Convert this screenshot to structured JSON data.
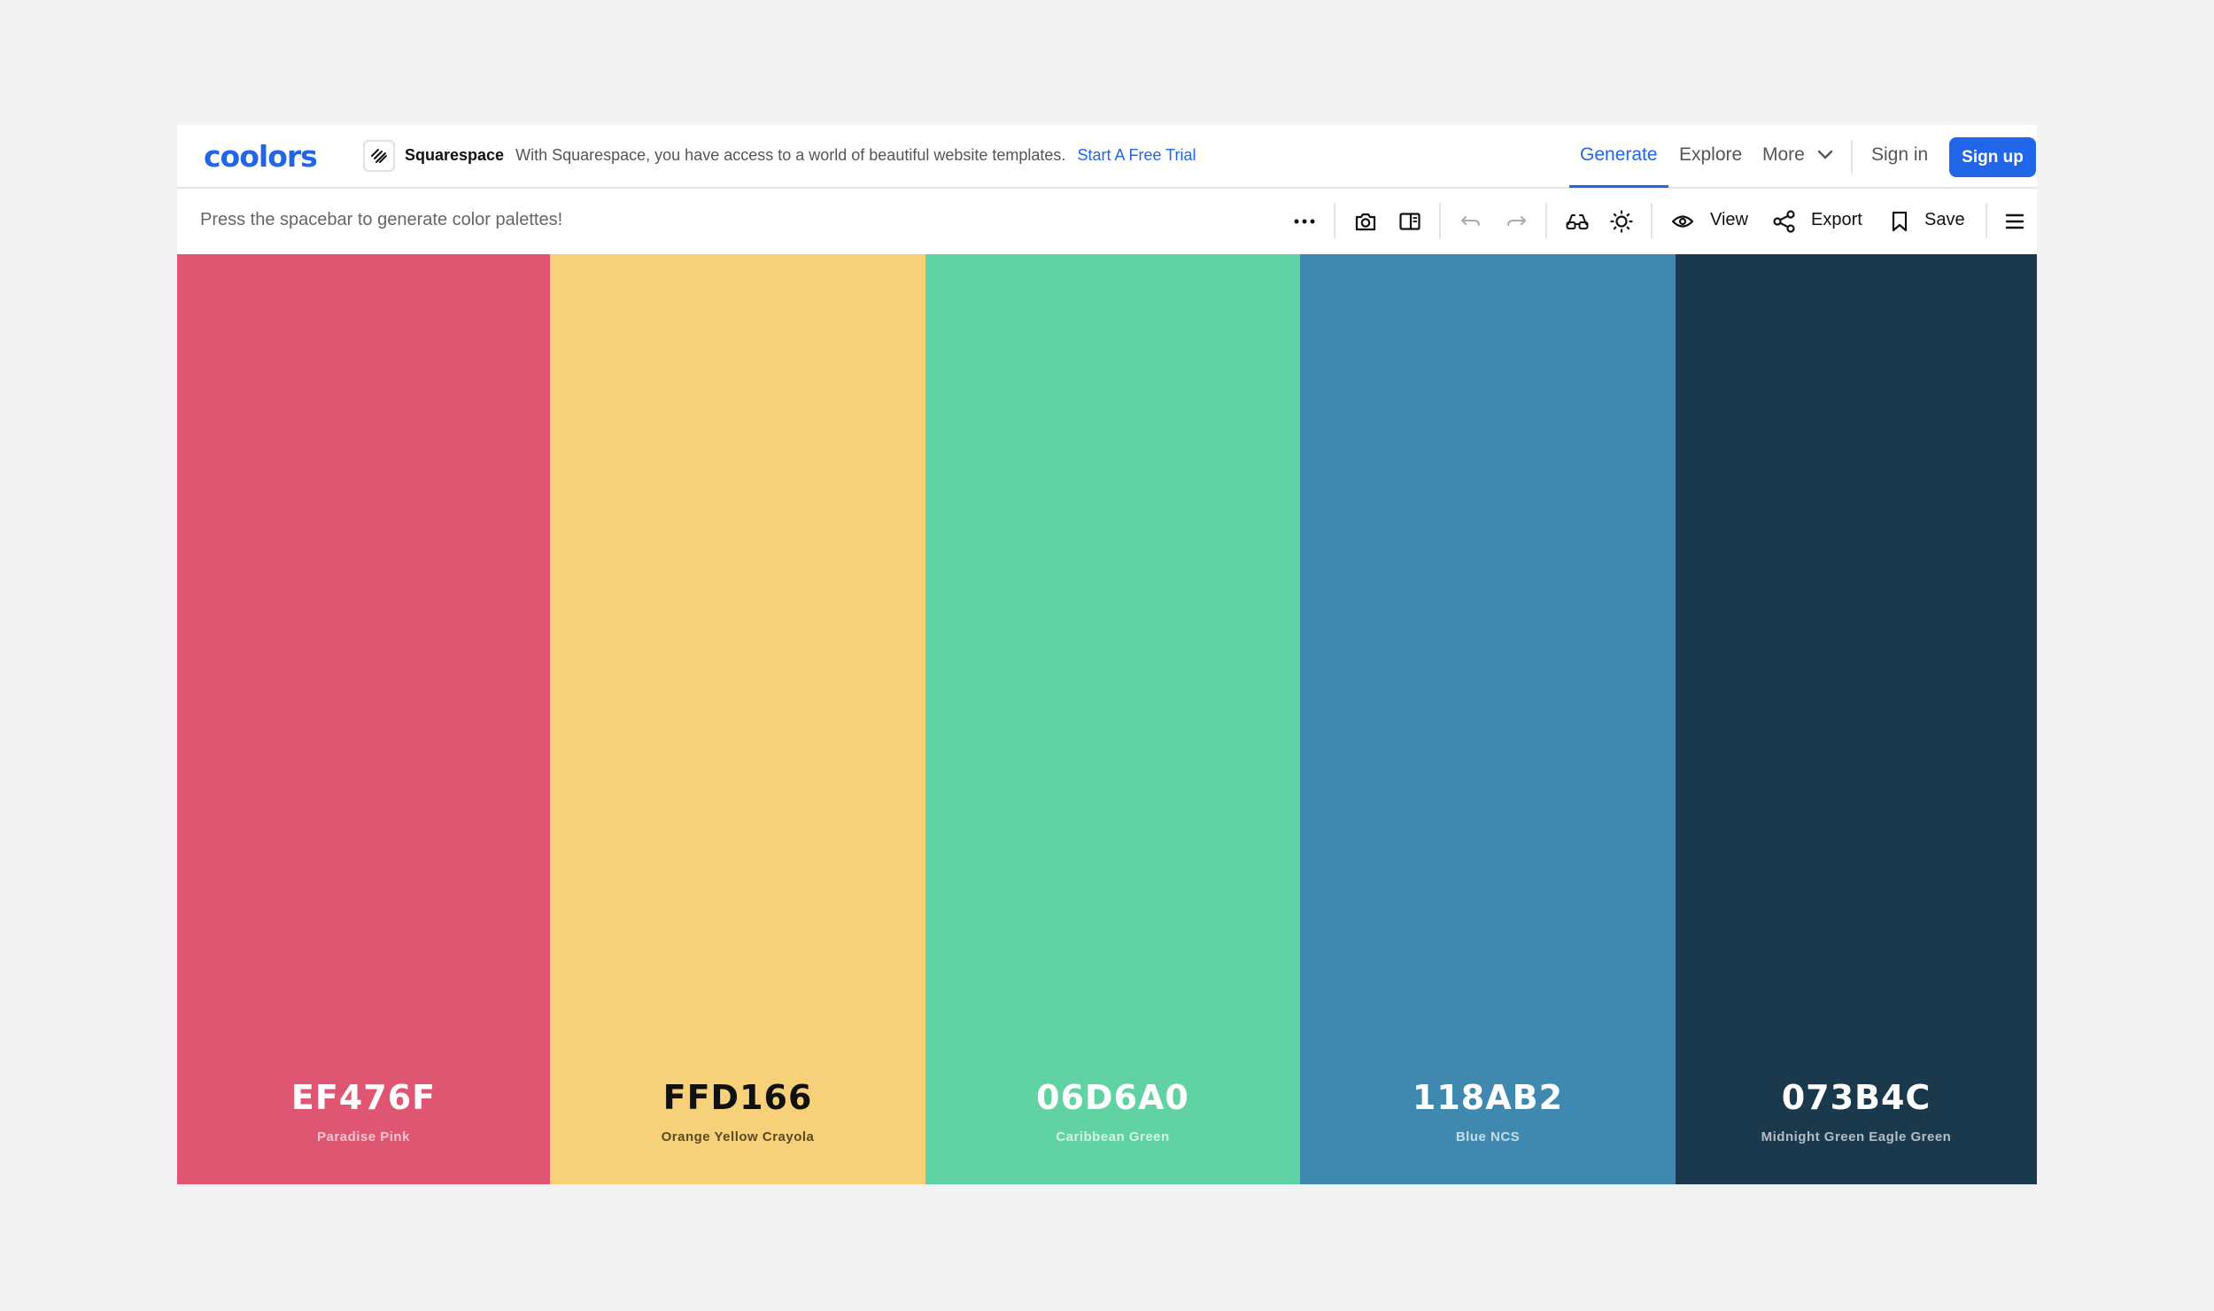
{
  "nav": {
    "logo": "coolors",
    "promo": {
      "brand": "Squarespace",
      "text": "With Squarespace, you have access to a world of beautiful website templates.",
      "cta": "Start A Free Trial"
    },
    "links": {
      "generate": "Generate",
      "explore": "Explore",
      "more": "More",
      "signin": "Sign in",
      "signup": "Sign up"
    },
    "accent": "#2166e8"
  },
  "toolbar": {
    "hint": "Press the spacebar to generate color palettes!",
    "view_label": "View",
    "export_label": "Export",
    "save_label": "Save",
    "icons": [
      "more-options-icon",
      "camera-icon",
      "sidebar-icon",
      "undo-icon",
      "redo-icon",
      "glasses-icon",
      "sun-icon",
      "eye-icon",
      "share-icon",
      "bookmark-icon",
      "menu-icon"
    ]
  },
  "palette": [
    {
      "hex": "EF476F",
      "name": "Paradise Pink",
      "bg": "#df5673",
      "text": "#ffffff",
      "sub": "#f6c6d1"
    },
    {
      "hex": "FFD166",
      "name": "Orange Yellow Crayola",
      "bg": "#f6d17a",
      "text": "#111111",
      "sub": "#5a4a22"
    },
    {
      "hex": "06D6A0",
      "name": "Caribbean Green",
      "bg": "#61d2a3",
      "text": "#ffffff",
      "sub": "#d3f3e6"
    },
    {
      "hex": "118AB2",
      "name": "Blue NCS",
      "bg": "#3f89b1",
      "text": "#ffffff",
      "sub": "#c6dde9"
    },
    {
      "hex": "073B4C",
      "name": "Midnight Green Eagle Green",
      "bg": "#1b394c",
      "text": "#ffffff",
      "sub": "#b3bec6"
    }
  ]
}
